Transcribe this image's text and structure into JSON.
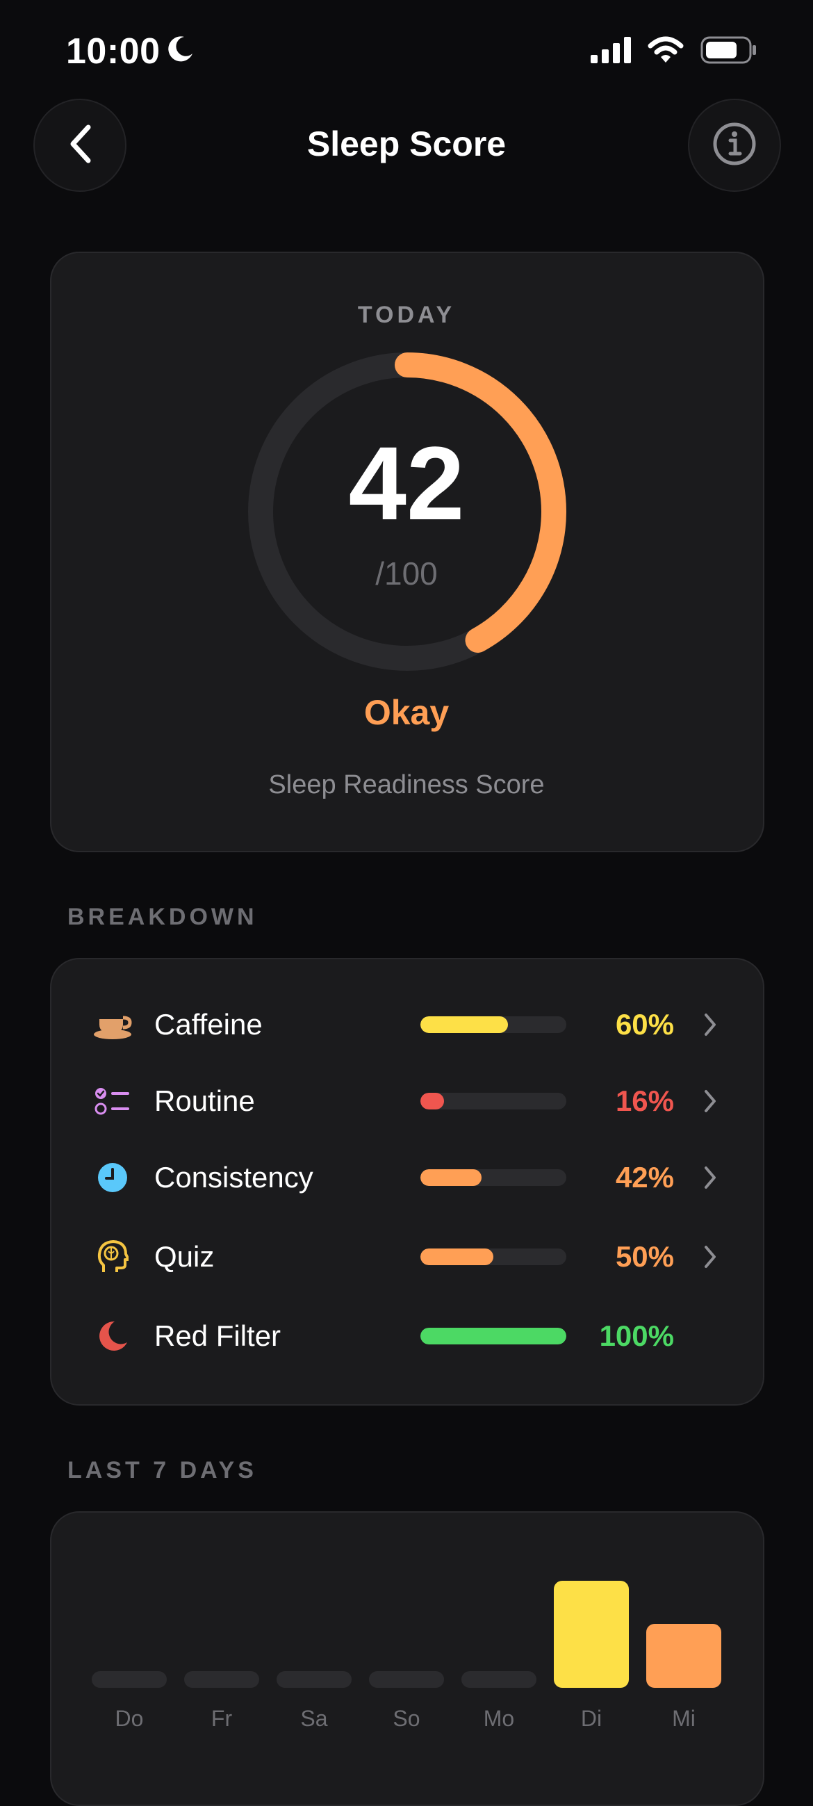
{
  "status_bar": {
    "time": "10:00",
    "focus_icon": "moon-icon",
    "icons": [
      "cellular-signal-icon",
      "wifi-icon",
      "battery-icon"
    ]
  },
  "nav": {
    "title": "Sleep Score",
    "back_icon": "chevron-left-icon",
    "info_icon": "info-icon"
  },
  "score_card": {
    "label": "TODAY",
    "score": "42",
    "max": "/100",
    "score_fraction": 0.42,
    "rating": "Okay",
    "subtitle": "Sleep Readiness Score",
    "accent": "#ff9f55"
  },
  "breakdown": {
    "title": "BREAKDOWN",
    "items": [
      {
        "label": "Caffeine",
        "value": "60%",
        "fraction": 0.6,
        "color": "#fde047",
        "icon": "coffee-cup-icon",
        "has_chevron": true
      },
      {
        "label": "Routine",
        "value": "16%",
        "fraction": 0.16,
        "color": "#f0564f",
        "icon": "checklist-icon",
        "has_chevron": true
      },
      {
        "label": "Consistency",
        "value": "42%",
        "fraction": 0.42,
        "color": "#ff9f55",
        "icon": "clock-icon",
        "has_chevron": true
      },
      {
        "label": "Quiz",
        "value": "50%",
        "fraction": 0.5,
        "color": "#ff9f55",
        "icon": "brain-head-icon",
        "has_chevron": true
      },
      {
        "label": "Red Filter",
        "value": "100%",
        "fraction": 1.0,
        "color": "#4cd964",
        "icon": "crescent-moon-icon",
        "has_chevron": false
      }
    ]
  },
  "last7": {
    "title": "LAST 7 DAYS",
    "chart_data": {
      "type": "bar",
      "categories": [
        "Do",
        "Fr",
        "Sa",
        "So",
        "Mo",
        "Di",
        "Mi"
      ],
      "values": [
        null,
        null,
        null,
        null,
        null,
        70,
        42
      ],
      "ylim": [
        0,
        100
      ],
      "colors": [
        "#2b2b2e",
        "#2b2b2e",
        "#2b2b2e",
        "#2b2b2e",
        "#2b2b2e",
        "#fde047",
        "#ff9f55"
      ],
      "empty_color": "#2b2b2e",
      "grid": false
    }
  }
}
